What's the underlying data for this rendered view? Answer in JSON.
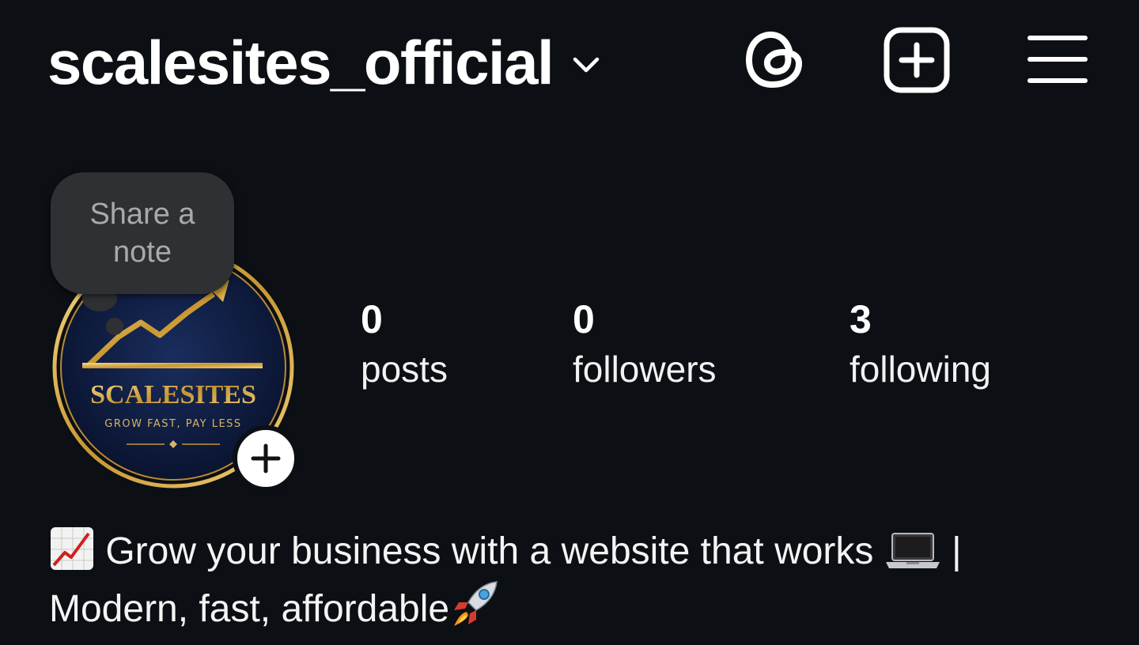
{
  "header": {
    "username": "scalesites_official",
    "icons": [
      "chevron-down-icon",
      "threads-icon",
      "add-post-icon",
      "menu-icon"
    ]
  },
  "note": {
    "text": "Share a note"
  },
  "avatar": {
    "brand": "SCALESITES",
    "tagline": "GROW FAST, PAY LESS"
  },
  "stats": [
    {
      "value": "0",
      "label": "posts"
    },
    {
      "value": "0",
      "label": "followers"
    },
    {
      "value": "3",
      "label": "following"
    }
  ],
  "bio": {
    "line1": "Grow your business with a website that works",
    "separator": "|",
    "line2": "Modern, fast, affordable",
    "emojis": [
      "chart-increasing-emoji",
      "laptop-emoji",
      "rocket-emoji"
    ]
  },
  "colors": {
    "background": "#0c0f14",
    "text": "#ffffff",
    "note_bubble": "#2f3033",
    "logo_gold": "#d4a84a",
    "logo_navy": "#101d3f"
  }
}
